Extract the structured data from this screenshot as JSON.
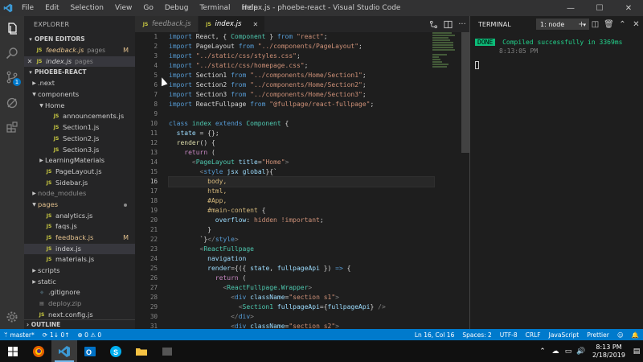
{
  "window": {
    "title": "index.js - phoebe-react - Visual Studio Code"
  },
  "menu": [
    "File",
    "Edit",
    "Selection",
    "View",
    "Go",
    "Debug",
    "Terminal",
    "Help"
  ],
  "window_controls": {
    "minimize": "—",
    "maximize": "☐",
    "close": "✕"
  },
  "activity": {
    "scm_badge": "1"
  },
  "sidebar": {
    "title": "EXPLORER",
    "open_editors_label": "OPEN EDITORS",
    "open_editors": [
      {
        "name": "feedback.js",
        "dir": "pages",
        "status": "M"
      },
      {
        "name": "index.js",
        "dir": "pages",
        "status": ""
      }
    ],
    "project_label": "PHOEBE-REACT",
    "tree": [
      {
        "name": ".next",
        "type": "folder",
        "depth": 0,
        "open": false
      },
      {
        "name": "components",
        "type": "folder",
        "depth": 0,
        "open": true
      },
      {
        "name": "Home",
        "type": "folder",
        "depth": 1,
        "open": true
      },
      {
        "name": "announcements.js",
        "type": "file",
        "depth": 2
      },
      {
        "name": "Section1.js",
        "type": "file",
        "depth": 2
      },
      {
        "name": "Section2.js",
        "type": "file",
        "depth": 2
      },
      {
        "name": "Section3.js",
        "type": "file",
        "depth": 2
      },
      {
        "name": "LearningMaterials",
        "type": "folder",
        "depth": 1,
        "open": false
      },
      {
        "name": "PageLayout.js",
        "type": "file",
        "depth": 1
      },
      {
        "name": "Sidebar.js",
        "type": "file",
        "depth": 1
      },
      {
        "name": "node_modules",
        "type": "folder",
        "depth": 0,
        "open": false,
        "grey": true
      },
      {
        "name": "pages",
        "type": "folder",
        "depth": 0,
        "open": true,
        "dot": true,
        "modified": true
      },
      {
        "name": "analytics.js",
        "type": "file",
        "depth": 1
      },
      {
        "name": "faqs.js",
        "type": "file",
        "depth": 1
      },
      {
        "name": "feedback.js",
        "type": "file",
        "depth": 1,
        "status": "M",
        "modified": true
      },
      {
        "name": "index.js",
        "type": "file",
        "depth": 1,
        "active": true
      },
      {
        "name": "materials.js",
        "type": "file",
        "depth": 1
      },
      {
        "name": "scripts",
        "type": "folder",
        "depth": 0,
        "open": false
      },
      {
        "name": "static",
        "type": "folder",
        "depth": 0,
        "open": false
      },
      {
        "name": ".gitignore",
        "type": "git",
        "depth": 0
      },
      {
        "name": "deploy.zip",
        "type": "zip",
        "depth": 0,
        "grey": true
      },
      {
        "name": "next.config.js",
        "type": "file",
        "depth": 0
      }
    ],
    "outline_label": "OUTLINE"
  },
  "tabs": [
    {
      "name": "feedback.js",
      "active": false
    },
    {
      "name": "index.js",
      "active": true,
      "close": "✕"
    }
  ],
  "editor": {
    "current_line": 16,
    "lines": [
      [
        [
          "k",
          "import "
        ],
        [
          "p",
          "React, { "
        ],
        [
          "t",
          "Component"
        ],
        [
          "p",
          " } "
        ],
        [
          "k",
          "from "
        ],
        [
          "s",
          "\"react\""
        ],
        [
          "p",
          ";"
        ]
      ],
      [
        [
          "k",
          "import "
        ],
        [
          "p",
          "PageLayout "
        ],
        [
          "k",
          "from "
        ],
        [
          "s",
          "\"../components/PageLayout\""
        ],
        [
          "p",
          ";"
        ]
      ],
      [
        [
          "k",
          "import "
        ],
        [
          "s",
          "\"../static/css/styles.css\""
        ],
        [
          "p",
          ";"
        ]
      ],
      [
        [
          "k",
          "import "
        ],
        [
          "s",
          "\"../static/css/homepage.css\""
        ],
        [
          "p",
          ";"
        ]
      ],
      [
        [
          "k",
          "import "
        ],
        [
          "p",
          "Section1 "
        ],
        [
          "k",
          "from "
        ],
        [
          "s",
          "\"../components/Home/Section1\""
        ],
        [
          "p",
          ";"
        ]
      ],
      [
        [
          "k",
          "import "
        ],
        [
          "p",
          "Section2 "
        ],
        [
          "k",
          "from "
        ],
        [
          "s",
          "\"../components/Home/Section2\""
        ],
        [
          "p",
          ";"
        ]
      ],
      [
        [
          "k",
          "import "
        ],
        [
          "p",
          "Section3 "
        ],
        [
          "k",
          "from "
        ],
        [
          "s",
          "\"../components/Home/Section3\""
        ],
        [
          "p",
          ";"
        ]
      ],
      [
        [
          "k",
          "import "
        ],
        [
          "p",
          "ReactFullpage "
        ],
        [
          "k",
          "from "
        ],
        [
          "s",
          "\"@fullpage/react-fullpage\""
        ],
        [
          "p",
          ";"
        ]
      ],
      [],
      [
        [
          "k",
          "class "
        ],
        [
          "t",
          "index "
        ],
        [
          "k",
          "extends "
        ],
        [
          "t",
          "Component"
        ],
        [
          "p",
          " {"
        ]
      ],
      [
        [
          "p",
          "  "
        ],
        [
          "v",
          "state"
        ],
        [
          "p",
          " = {};"
        ]
      ],
      [
        [
          "p",
          "  "
        ],
        [
          "f",
          "render"
        ],
        [
          "p",
          "() {"
        ]
      ],
      [
        [
          "p",
          "    "
        ],
        [
          "mimp",
          "return"
        ],
        [
          "p",
          " ("
        ]
      ],
      [
        [
          "p",
          "      "
        ],
        [
          "g",
          "<"
        ],
        [
          "t",
          "PageLayout"
        ],
        [
          "p",
          " "
        ],
        [
          "a",
          "title"
        ],
        [
          "p",
          "="
        ],
        [
          "s",
          "\"Home\""
        ],
        [
          "g",
          ">"
        ]
      ],
      [
        [
          "p",
          "        "
        ],
        [
          "g",
          "<"
        ],
        [
          "tg",
          "style"
        ],
        [
          "p",
          " "
        ],
        [
          "a",
          "jsx"
        ],
        [
          "p",
          " "
        ],
        [
          "a",
          "global"
        ],
        [
          "p",
          "}{`"
        ]
      ],
      [
        [
          "p",
          "          "
        ],
        [
          "css",
          "body,"
        ]
      ],
      [
        [
          "p",
          "          "
        ],
        [
          "css",
          "html,"
        ]
      ],
      [
        [
          "p",
          "          "
        ],
        [
          "css",
          "#App,"
        ]
      ],
      [
        [
          "p",
          "          "
        ],
        [
          "css",
          "#main-content"
        ],
        [
          "p",
          " {"
        ]
      ],
      [
        [
          "p",
          "            "
        ],
        [
          "a",
          "overflow"
        ],
        [
          "p",
          ": "
        ],
        [
          "s",
          "hidden !important"
        ],
        [
          "p",
          ";"
        ]
      ],
      [
        [
          "p",
          "          }"
        ]
      ],
      [
        [
          "p",
          "        `}"
        ],
        [
          "g",
          "</"
        ],
        [
          "tg",
          "style"
        ],
        [
          "g",
          ">"
        ]
      ],
      [
        [
          "p",
          "        "
        ],
        [
          "g",
          "<"
        ],
        [
          "t",
          "ReactFullpage"
        ]
      ],
      [
        [
          "p",
          "          "
        ],
        [
          "a",
          "navigation"
        ]
      ],
      [
        [
          "p",
          "          "
        ],
        [
          "a",
          "render"
        ],
        [
          "p",
          "={({ "
        ],
        [
          "v",
          "state"
        ],
        [
          "p",
          ", "
        ],
        [
          "v",
          "fullpageApi"
        ],
        [
          "p",
          " }) "
        ],
        [
          "k",
          "=>"
        ],
        [
          "p",
          " {"
        ]
      ],
      [
        [
          "p",
          "            "
        ],
        [
          "mimp",
          "return"
        ],
        [
          "p",
          " ("
        ]
      ],
      [
        [
          "p",
          "              "
        ],
        [
          "g",
          "<"
        ],
        [
          "t",
          "ReactFullpage.Wrapper"
        ],
        [
          "g",
          ">"
        ]
      ],
      [
        [
          "p",
          "                "
        ],
        [
          "g",
          "<"
        ],
        [
          "tg",
          "div"
        ],
        [
          "p",
          " "
        ],
        [
          "a",
          "className"
        ],
        [
          "p",
          "="
        ],
        [
          "s",
          "\"section s1\""
        ],
        [
          "g",
          ">"
        ]
      ],
      [
        [
          "p",
          "                  "
        ],
        [
          "g",
          "<"
        ],
        [
          "t",
          "Section1"
        ],
        [
          "p",
          " "
        ],
        [
          "a",
          "fullpageApi"
        ],
        [
          "p",
          "={"
        ],
        [
          "v",
          "fullpageApi"
        ],
        [
          "p",
          "} "
        ],
        [
          "g",
          "/>"
        ]
      ],
      [
        [
          "p",
          "                "
        ],
        [
          "g",
          "</"
        ],
        [
          "tg",
          "div"
        ],
        [
          "g",
          ">"
        ]
      ],
      [
        [
          "p",
          "                "
        ],
        [
          "g",
          "<"
        ],
        [
          "tg",
          "div"
        ],
        [
          "p",
          " "
        ],
        [
          "a",
          "className"
        ],
        [
          "p",
          "="
        ],
        [
          "s",
          "\"section s2\""
        ],
        [
          "g",
          ">"
        ]
      ]
    ]
  },
  "terminal": {
    "title": "TERMINAL",
    "selected_shell": "1: node",
    "done_label": "DONE",
    "message": "Compiled successfully in 3369ms",
    "time": "8:13:05 PM"
  },
  "status": {
    "branch": "master*",
    "sync": "1↓ 0↑",
    "problems": "⊗ 0  ⚠ 0",
    "position": "Ln 16, Col 16",
    "spaces": "Spaces: 2",
    "encoding": "UTF-8",
    "eol": "CRLF",
    "language": "JavaScript",
    "formatter": "Prettier"
  },
  "taskbar": {
    "time": "8:13 PM",
    "date": "2/18/2019"
  },
  "colors": {
    "accent": "#007acc",
    "done_green": "#0dbc79",
    "modified": "#e2c08d"
  }
}
